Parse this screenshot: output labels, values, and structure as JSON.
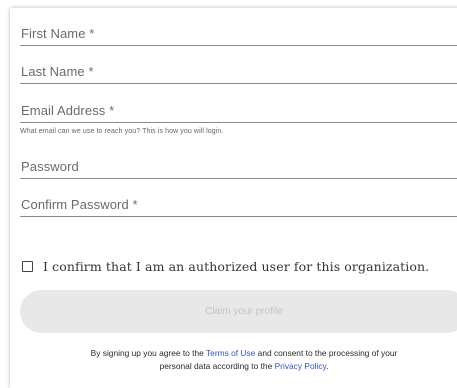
{
  "form": {
    "first_name_label": "First Name",
    "first_name_required": "*",
    "last_name_label": "Last Name",
    "last_name_required": "*",
    "email_label": "Email Address",
    "email_required": "*",
    "email_hint": "What email can we use to reach you? This is how you will login.",
    "password_label": "Password",
    "confirm_password_label": "Confirm Password",
    "confirm_password_required": "*"
  },
  "authorization": {
    "checkbox_label": "I confirm that I am an authorized user for this organization.",
    "checked": false
  },
  "submit": {
    "label": "Claim your profile",
    "enabled": false
  },
  "terms": {
    "prefix": "By signing up you agree to the ",
    "terms_link": "Terms of Use",
    "middle": " and consent to the processing of your",
    "line2_prefix": "personal data according to the ",
    "privacy_link": "Privacy Policy",
    "suffix": "."
  },
  "colors": {
    "link": "#2f55c8",
    "button_bg": "#e8e8e8",
    "button_text": "#c4c4c4",
    "underline": "#8a8a8a"
  }
}
